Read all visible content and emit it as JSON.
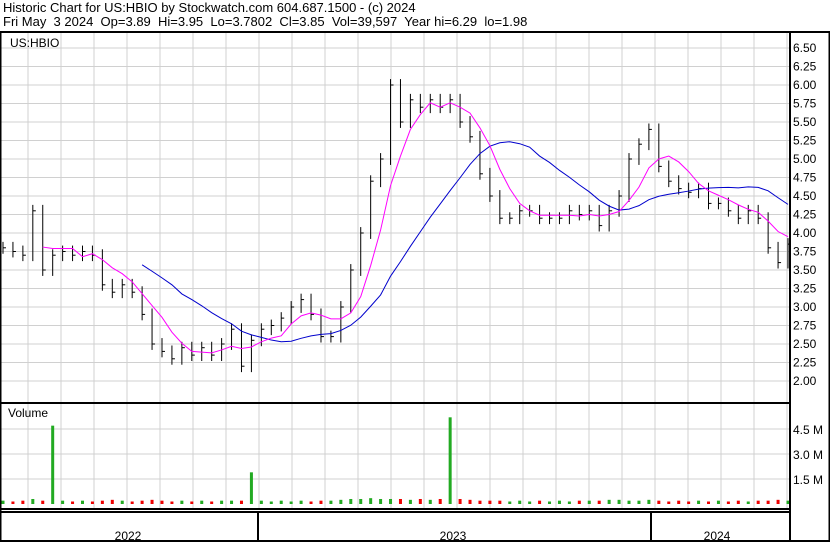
{
  "header": {
    "title": "Historic Chart for US:HBIO by Stockwatch.com 604.687.1500 - (c) 2024",
    "quote": "Fri May  3 2024  Op=3.89  Hi=3.95  Lo=3.7802  Cl=3.85  Vol=39,597  Year hi=6.29  lo=1.98"
  },
  "chart_data": {
    "type": "line",
    "title": "US:HBIO",
    "volume_label": "Volume",
    "price_ticks": [
      "6.50",
      "6.25",
      "6.00",
      "5.75",
      "5.50",
      "5.25",
      "5.00",
      "4.75",
      "4.50",
      "4.25",
      "4.00",
      "3.75",
      "3.50",
      "3.25",
      "3.00",
      "2.75",
      "2.50",
      "2.25",
      "2.00"
    ],
    "price_range": [
      2.0,
      6.5
    ],
    "volume_ticks": [
      {
        "label": "4.5 M",
        "value": 4.5
      },
      {
        "label": "3.0 M",
        "value": 3.0
      },
      {
        "label": "1.5 M",
        "value": 1.5
      }
    ],
    "year_labels": [
      "2022",
      "2023",
      "2024"
    ],
    "colors": {
      "price": "#000000",
      "ma_short": "#ff00ff",
      "ma_long": "#0000cc",
      "vol_up": "#22aa22",
      "vol_down": "#ee0000",
      "grid": "#d0d0d0"
    },
    "close": [
      3.8,
      3.75,
      3.7,
      4.3,
      3.5,
      3.7,
      3.75,
      3.7,
      3.75,
      3.7,
      3.3,
      3.2,
      3.3,
      3.2,
      2.9,
      2.5,
      2.4,
      2.3,
      2.45,
      2.35,
      2.45,
      2.35,
      2.5,
      2.7,
      2.2,
      2.55,
      2.7,
      2.75,
      2.85,
      3.0,
      3.1,
      2.9,
      2.6,
      2.6,
      3.0,
      3.5,
      4.0,
      4.7,
      5.0,
      6.0,
      5.5,
      5.8,
      5.7,
      5.8,
      5.7,
      5.8,
      5.5,
      5.3,
      4.8,
      4.5,
      4.2,
      4.2,
      4.3,
      4.3,
      4.2,
      4.2,
      4.2,
      4.3,
      4.25,
      4.3,
      4.1,
      4.3,
      4.5,
      5.0,
      5.2,
      5.4,
      4.9,
      4.7,
      4.6,
      4.55,
      4.6,
      4.4,
      4.4,
      4.3,
      4.2,
      4.3,
      4.2,
      3.8,
      3.6,
      3.85
    ],
    "volume_millions": [
      0.2,
      0.15,
      0.2,
      0.3,
      0.2,
      4.7,
      0.2,
      0.15,
      0.2,
      0.15,
      0.2,
      0.25,
      0.2,
      0.15,
      0.2,
      0.25,
      0.2,
      0.15,
      0.2,
      0.15,
      0.2,
      0.15,
      0.2,
      0.2,
      0.2,
      1.9,
      0.2,
      0.15,
      0.2,
      0.15,
      0.2,
      0.15,
      0.2,
      0.2,
      0.25,
      0.3,
      0.3,
      0.35,
      0.3,
      0.3,
      0.3,
      0.25,
      0.3,
      0.25,
      0.3,
      5.2,
      0.3,
      0.25,
      0.2,
      0.2,
      0.2,
      0.15,
      0.2,
      0.15,
      0.2,
      0.15,
      0.2,
      0.15,
      0.2,
      0.2,
      0.2,
      0.25,
      0.25,
      0.2,
      0.2,
      0.25,
      0.2,
      0.15,
      0.2,
      0.15,
      0.2,
      0.15,
      0.2,
      0.15,
      0.2,
      0.15,
      0.2,
      0.2,
      0.25,
      0.2
    ],
    "ma_short_window": 5,
    "ma_long_window": 15
  }
}
